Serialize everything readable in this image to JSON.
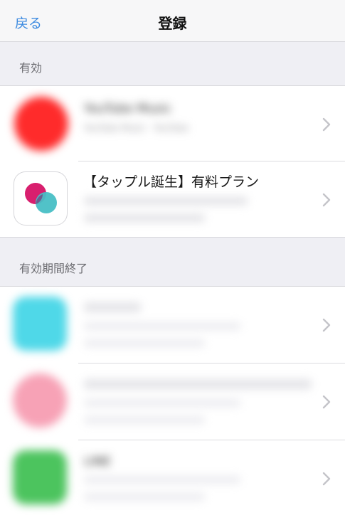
{
  "nav": {
    "back_label": "戻る",
    "title": "登録"
  },
  "sections": {
    "active_header": "有効",
    "expired_header": "有効期間終了"
  },
  "active": [
    {
      "title": "YouTube Music",
      "line1": "YouTube Music · YouTube",
      "line2": "",
      "icon": "youtube-music-icon",
      "color": "#ff2b2b"
    },
    {
      "title": "【タップル誕生】有料プラン",
      "line1": "",
      "line2": "",
      "icon": "tapple-icon",
      "colors": [
        "#d81f6e",
        "#48bfc5"
      ]
    }
  ],
  "expired": [
    {
      "title": "",
      "line1": "",
      "line2": "",
      "icon": "app-icon-cyan",
      "color": "#4fd8e8"
    },
    {
      "title": "",
      "line1": "",
      "line2": "",
      "icon": "app-icon-pastel",
      "color": "#f7a2b6"
    },
    {
      "title": "LINE",
      "line1": "",
      "line2": "",
      "icon": "line-icon",
      "color": "#4cc45e"
    }
  ]
}
